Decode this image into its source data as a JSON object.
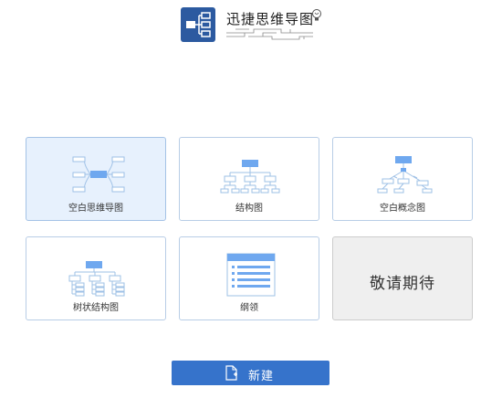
{
  "app": {
    "title": "迅捷思维导图"
  },
  "templates": [
    {
      "label": "空白思维导图"
    },
    {
      "label": "结构图"
    },
    {
      "label": "空白概念图"
    },
    {
      "label": "树状结构图"
    },
    {
      "label": "纲领"
    }
  ],
  "coming_soon": {
    "text": "敬请期待"
  },
  "new_button": {
    "label": "新建"
  },
  "colors": {
    "accent": "#3673cb",
    "logo": "#2c5aa0",
    "node_fill": "#6fa8ef",
    "node_stroke": "#9ec0e6",
    "card_selected_bg": "#e7f1fd",
    "card_disabled_bg": "#efefef"
  },
  "icons": [
    "logo-mindmap-icon",
    "lightbulb-icon",
    "new-file-icon"
  ]
}
